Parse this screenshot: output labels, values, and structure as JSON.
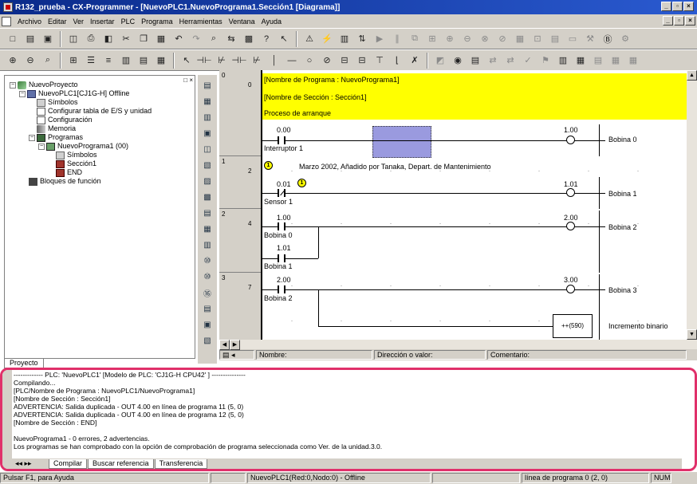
{
  "window": {
    "title": "R132_prueba - CX-Programmer - [NuevoPLC1.NuevoPrograma1.Sección1 [Diagrama]]"
  },
  "menu": [
    "Archivo",
    "Editar",
    "Ver",
    "Insertar",
    "PLC",
    "Programa",
    "Herramientas",
    "Ventana",
    "Ayuda"
  ],
  "project_tree": {
    "tab_label": "Proyecto",
    "items": [
      {
        "label": "NuevoProyecto",
        "icon": "project-icon"
      },
      {
        "label": "NuevoPLC1[CJ1G-H] Offline",
        "icon": "plc-icon"
      },
      {
        "label": "Símbolos",
        "icon": "symbols-icon"
      },
      {
        "label": "Configurar tabla de E/S y unidad",
        "icon": "io-table-icon"
      },
      {
        "label": "Configuración",
        "icon": "settings-icon"
      },
      {
        "label": "Memoria",
        "icon": "memory-icon"
      },
      {
        "label": "Programas",
        "icon": "programs-icon"
      },
      {
        "label": "NuevoPrograma1 (00)",
        "icon": "program-icon"
      },
      {
        "label": "Símbolos",
        "icon": "symbols-icon"
      },
      {
        "label": "Sección1",
        "icon": "section-icon"
      },
      {
        "label": "END",
        "icon": "section-icon"
      },
      {
        "label": "Bloques de función",
        "icon": "function-block-icon"
      }
    ]
  },
  "ladder": {
    "rungs": [
      {
        "rung": "0",
        "line": "0"
      },
      {
        "rung": "1",
        "line": "2"
      },
      {
        "rung": "2",
        "line": "4"
      },
      {
        "rung": "3",
        "line": "7"
      }
    ],
    "header": {
      "program_name": "[Nombre de Programa : NuevoPrograma1]",
      "section_name": "[Nombre de Sección : Sección1]",
      "comment": "Proceso de arranque"
    },
    "rung0": {
      "contact_addr": "0.00",
      "contact_name": "Interruptor 1",
      "coil_addr": "1.00",
      "coil_name": "Bobina 0"
    },
    "rung1": {
      "comment": "Marzo 2002, Añadido por Tanaka, Depart. de Mantenimiento",
      "comment_marker": "1",
      "contact_addr": "0.01",
      "contact_name": "Sensor 1",
      "coil_addr": "1.01",
      "coil_name": "Bobina 1"
    },
    "rung2": {
      "contact1_addr": "1.00",
      "contact1_name": "Bobina 0",
      "contact2_addr": "1.01",
      "contact2_name": "Bobina 1",
      "coil_addr": "2.00",
      "coil_name": "Bobina 2"
    },
    "rung3": {
      "contact_addr": "2.00",
      "contact_name": "Bobina 2",
      "coil_addr": "3.00",
      "coil_name": "Bobina 3",
      "inst": "++(590)",
      "inst_name": "Incremento binario"
    }
  },
  "ladder_fields": {
    "name_label": "Nombre:",
    "addr_label": "Dirección o valor:",
    "comment_label": "Comentario:"
  },
  "output": {
    "lines": [
      "------------- PLC: 'NuevoPLC1' [Modelo de PLC: 'CJ1G-H CPU42' ] ---------------",
      "Compilando...",
      "[PLC/Nombre de Programa : NuevoPLC1/NuevoPrograma1]",
      "[Nombre de Sección : Sección1]",
      "ADVERTENCIA: Salida duplicada - OUT 4.00 en línea de programa 11 (5, 0)",
      "ADVERTENCIA: Salida duplicada - OUT 4.00 en línea de programa 12 (5, 0)",
      "[Nombre de Sección : END]",
      "",
      "NuevoPrograma1 - 0 errores, 2 advertencias.",
      "Los programas se han comprobado con la opción de comprobación de programa seleccionada como Ver. de la unidad.3.0."
    ],
    "tabs": [
      "Compilar",
      "Buscar referencia",
      "Transferencia"
    ]
  },
  "statusbar": {
    "help": "Pulsar F1, para Ayuda",
    "plc": "NuevoPLC1(Red:0,Nodo:0) - Offline",
    "position": "línea de programa 0 (2, 0)",
    "num": "NUM"
  }
}
